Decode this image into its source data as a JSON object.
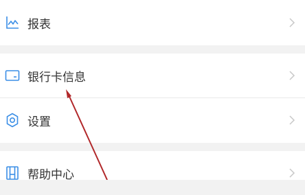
{
  "menu": {
    "groups": [
      {
        "items": [
          {
            "label": "报表",
            "icon": "chart-icon"
          }
        ]
      },
      {
        "items": [
          {
            "label": "银行卡信息",
            "icon": "bank-card-icon"
          },
          {
            "label": "设置",
            "icon": "gear-icon"
          }
        ]
      },
      {
        "items": [
          {
            "label": "帮助中心",
            "icon": "book-icon"
          }
        ]
      }
    ]
  },
  "colors": {
    "icon": "#3a8ee6",
    "chevron": "#c8c8c8",
    "text": "#333333",
    "background": "#f2f2f2",
    "annotation_arrow": "#b1282a"
  }
}
